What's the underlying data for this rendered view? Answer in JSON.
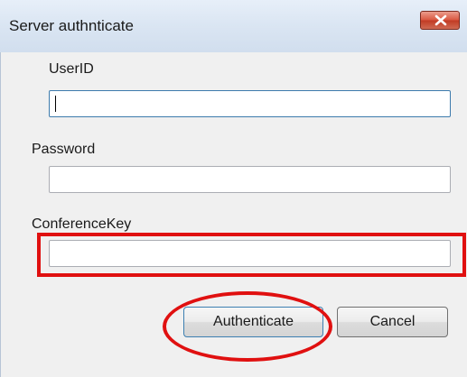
{
  "window": {
    "title": "Server authnticate",
    "close_label": "X"
  },
  "form": {
    "userid_label": "UserID",
    "userid_value": "",
    "password_label": "Password",
    "password_value": "",
    "conference_key_label": "ConferenceKey",
    "conference_key_value": ""
  },
  "buttons": {
    "authenticate_label": "Authenticate",
    "cancel_label": "Cancel"
  },
  "colors": {
    "highlight": "#e01010",
    "close_button": "#c13a23",
    "focus_border": "#3d7bad"
  }
}
